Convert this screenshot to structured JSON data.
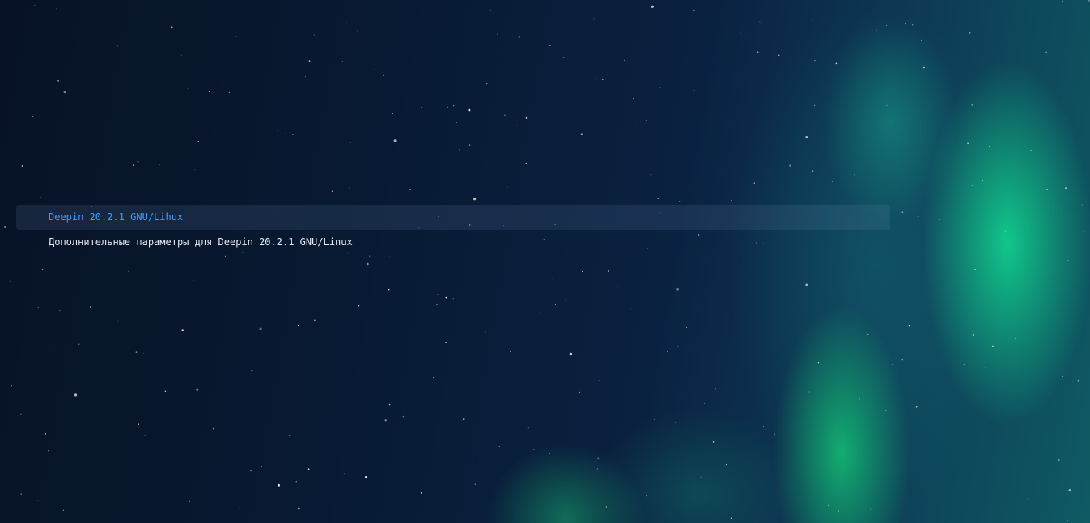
{
  "boot_menu": {
    "entries": [
      {
        "label": "Deepin 20.2.1 GNU/Lihux",
        "selected": true
      },
      {
        "label": "Дополнительные параметры для Deepin 20.2.1 GNU/Linux",
        "selected": false
      }
    ],
    "selected_color": "#3f9bff",
    "text_color": "#e6edf2"
  }
}
